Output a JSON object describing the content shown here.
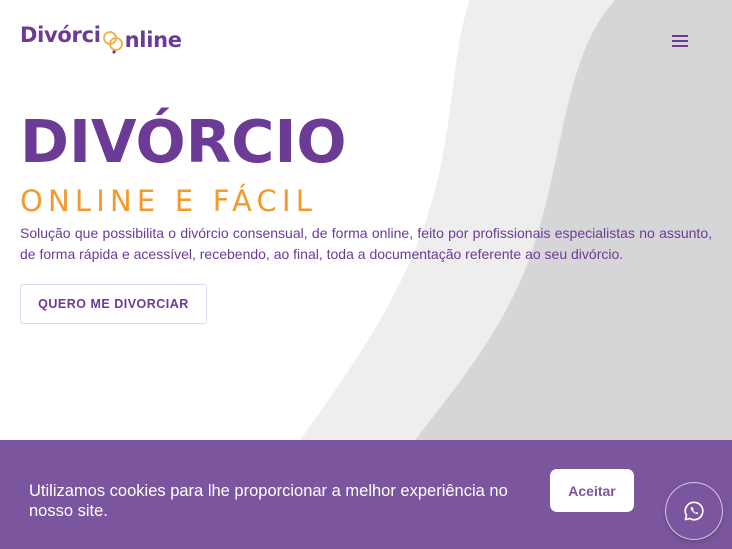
{
  "header": {
    "logo_part1": "Divórci",
    "logo_part2": "nline",
    "menu_icon": "hamburger-menu-icon"
  },
  "hero": {
    "title": "DIVÓRCIO",
    "subtitle": "ONLINE E FÁCIL",
    "description": "Solução que possibilita o divórcio consensual, de forma online, feito por profissionais especialistas no assunto, de forma rápida e acessível, recebendo, ao final, toda a documentação referente ao seu divórcio.",
    "cta_label": "QUERO ME DIVORCIAR"
  },
  "cookie_banner": {
    "text": "Utilizamos cookies para lhe proporcionar a melhor experiência no nosso site.",
    "accept_label": "Aceitar"
  },
  "floating": {
    "whatsapp_icon": "whatsapp-icon"
  },
  "colors": {
    "brand_purple": "#6b3b96",
    "banner_purple": "#7b559e",
    "accent_orange": "#f39a2b",
    "ring_gold": "#f0b040",
    "shape_gray": "#d6d5d8",
    "shape_light": "#eeeeef"
  }
}
